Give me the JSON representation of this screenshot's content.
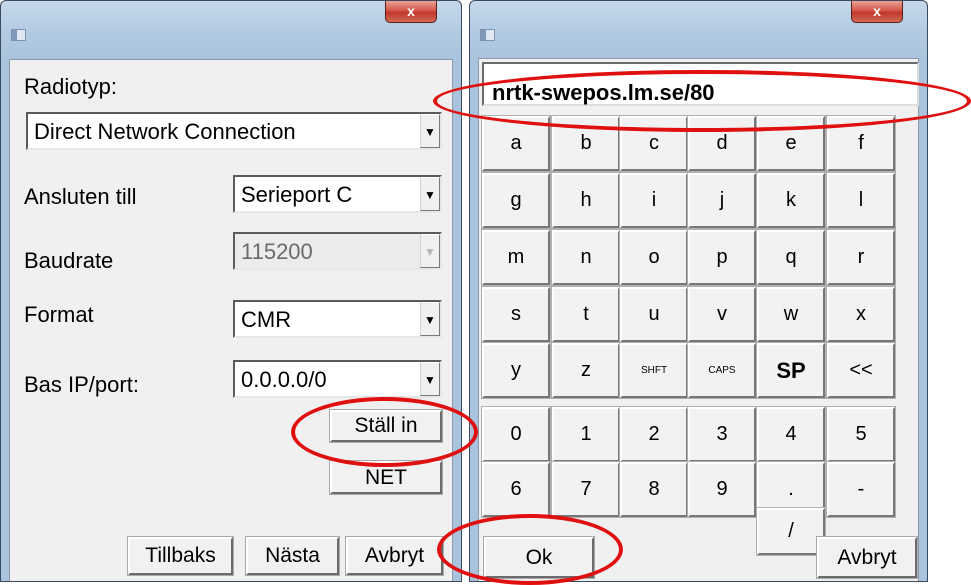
{
  "left_window": {
    "close_label": "x",
    "radio_label": "Radiotyp:",
    "radio_value": "Direct Network Connection",
    "connected_label": "Ansluten till",
    "connected_value": "Serieport C",
    "baud_label": "Baudrate",
    "baud_value": "115200",
    "format_label": "Format",
    "format_value": "CMR",
    "ip_label": "Bas IP/port:",
    "ip_value": "0.0.0.0/0",
    "setup_button": "Ställ in",
    "net_button": "NET",
    "back_button": "Tillbaks",
    "next_button": "Nästa",
    "cancel_button": "Avbryt"
  },
  "right_window": {
    "close_label": "x",
    "input_value": "nrtk-swepos.lm.se/80",
    "keys": [
      [
        "a",
        "b",
        "c",
        "d",
        "e",
        "f"
      ],
      [
        "g",
        "h",
        "i",
        "j",
        "k",
        "l"
      ],
      [
        "m",
        "n",
        "o",
        "p",
        "q",
        "r"
      ],
      [
        "s",
        "t",
        "u",
        "v",
        "w",
        "x"
      ],
      [
        "y",
        "z",
        "SHFT",
        "CAPS",
        "SP",
        "<<"
      ],
      [
        "0",
        "1",
        "2",
        "3",
        "4",
        "5"
      ],
      [
        "6",
        "7",
        "8",
        "9",
        ".",
        "-"
      ]
    ],
    "slash_key": "/",
    "ok_button": "Ok",
    "cancel_button": "Avbryt"
  },
  "annotation_color": "#e01010"
}
